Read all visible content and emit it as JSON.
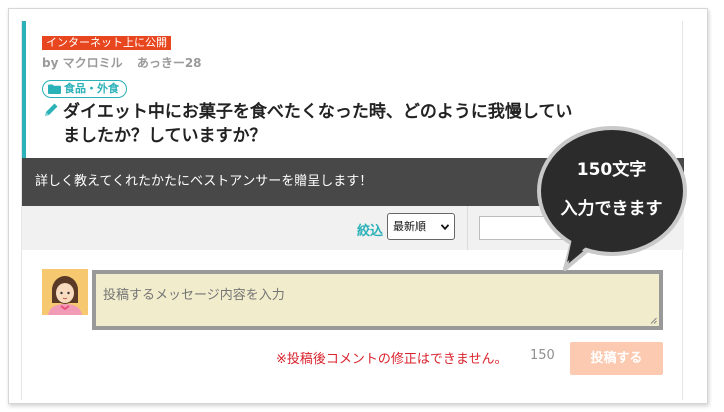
{
  "post": {
    "visibility_badge": "インターネット上に公開",
    "by_label": "by",
    "author": "マクロミル",
    "nickname": "あっきー28",
    "category": "食品・外食",
    "title_line1": "ダイエット中にお菓子を食べたくなった時、どのように我慢してい",
    "title_line2": "ましたか？していますか？"
  },
  "notice": {
    "text": "詳しく教えてくれたかたにベストアンサーを贈呈します！"
  },
  "filter": {
    "label": "絞込",
    "sort_selected": "最新順",
    "search_value": ""
  },
  "comment": {
    "placeholder": "投稿するメッセージ内容を入力",
    "warning": "※投稿後コメントの修正はできません。",
    "char_count": "150",
    "submit_label": "投稿する"
  },
  "callout": {
    "line1": "150文字",
    "line2": "入力できます"
  },
  "colors": {
    "accent_teal": "#2bb1b8",
    "badge_red": "#e8461e",
    "notice_bg": "#484848",
    "warning_red": "#d9232d",
    "submit_bg": "#fccab0",
    "textarea_bg": "#f0eccc",
    "callout_bg": "#2b2b2b"
  },
  "icons": {
    "category": "folder-icon",
    "title": "pencil-icon",
    "avatar": "user-avatar-icon",
    "sort": "chevron-down-icon"
  }
}
